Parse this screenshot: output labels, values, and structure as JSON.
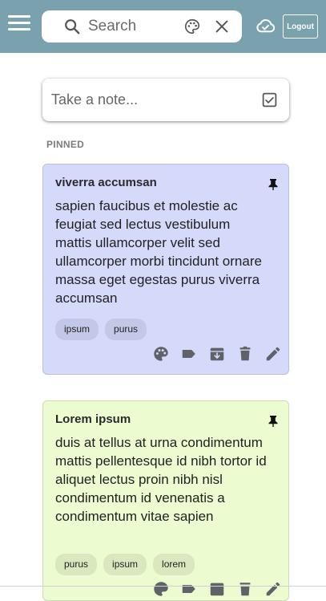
{
  "header": {
    "search": {
      "placeholder": "Search",
      "value": ""
    },
    "logout_label": "Logout",
    "background_color": "#7aa1ae",
    "icons": [
      "menu-icon",
      "search-icon",
      "palette-icon",
      "close-icon",
      "cloud-icon"
    ]
  },
  "compose": {
    "placeholder": "Take a note...",
    "icon": "checkbox-icon"
  },
  "pinned_label": "PINNED",
  "notes": [
    {
      "title": "viverra accumsan",
      "body": "sapien faucibus et molestie ac feugiat sed lectus vestibulum mattis ullamcorper velit sed ullamcorper morbi tincidunt ornare massa eget egestas purus viverra accumsan",
      "tags": [
        "ipsum",
        "purus"
      ],
      "color": "#d5dafb",
      "pinned": true
    },
    {
      "title": "Lorem ipsum",
      "body": "duis at tellus at urna condimentum mattis pellentesque id nibh tortor id aliquet lectus proin nibh nisl condimentum id venenatis a condimentum vitae sapien",
      "tags": [
        "purus",
        "ipsum",
        "lorem"
      ],
      "color": "#ecfcd0",
      "pinned": true
    }
  ],
  "note_actions": [
    "palette-icon",
    "label-icon",
    "archive-icon",
    "delete-icon",
    "edit-icon"
  ]
}
